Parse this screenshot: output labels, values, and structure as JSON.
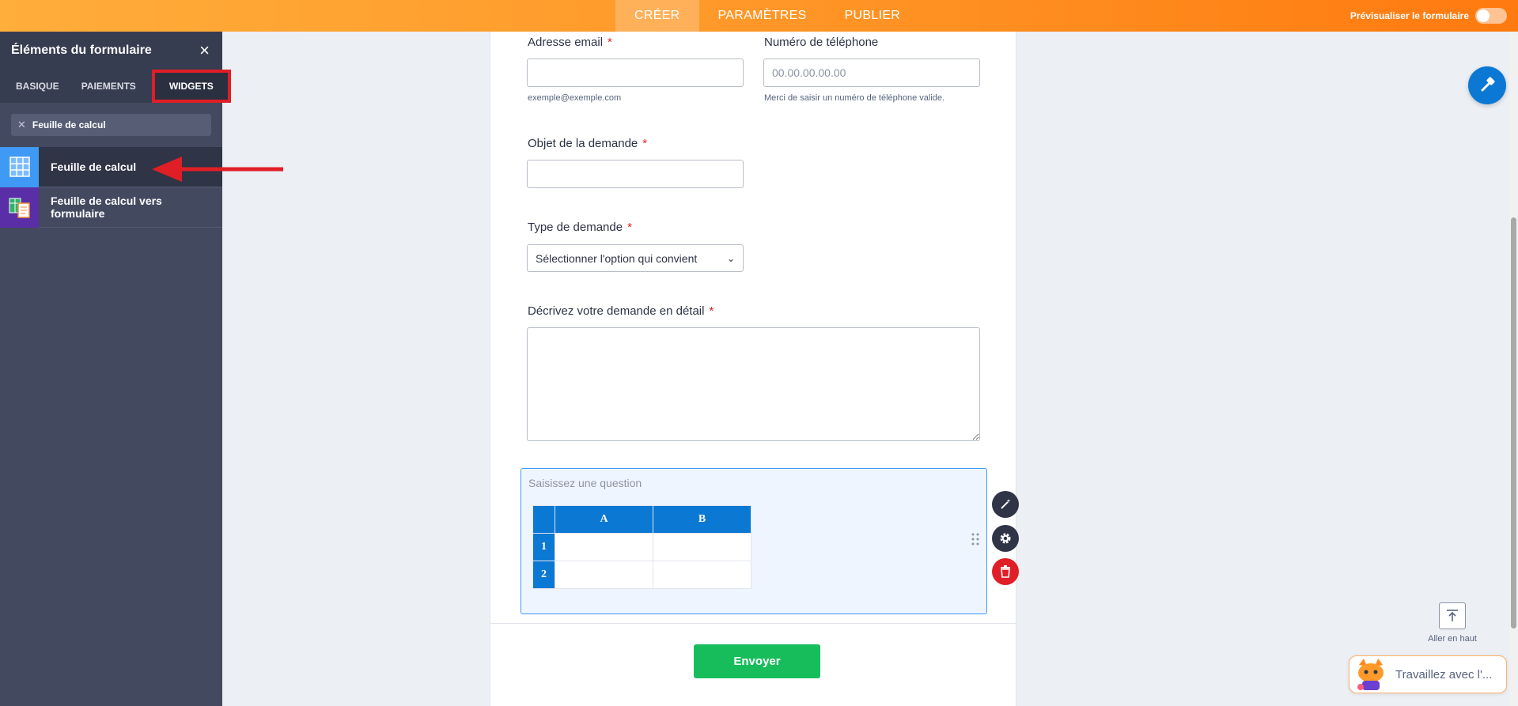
{
  "topbar": {
    "tabs": [
      {
        "label": "CRÉER"
      },
      {
        "label": "PARAMÈTRES"
      },
      {
        "label": "PUBLIER"
      }
    ],
    "preview_label": "Prévisualiser le formulaire"
  },
  "sidebar": {
    "title": "Éléments du formulaire",
    "tabs": [
      {
        "label": "BASIQUE"
      },
      {
        "label": "PAIEMENTS"
      },
      {
        "label": "WIDGETS"
      }
    ],
    "search_value": "Feuille de calcul",
    "items": [
      {
        "label": "Feuille de calcul"
      },
      {
        "label": "Feuille de calcul vers formulaire"
      }
    ]
  },
  "form": {
    "email": {
      "label": "Adresse email",
      "required": "*",
      "value": "",
      "hint": "exemple@exemple.com"
    },
    "phone": {
      "label": "Numéro de téléphone",
      "placeholder": "00.00.00.00.00",
      "hint": "Merci de saisir un numéro de téléphone valide."
    },
    "subject": {
      "label": "Objet de la demande",
      "required": "*"
    },
    "type": {
      "label": "Type de demande",
      "required": "*",
      "selected": "Sélectionner l'option qui convient"
    },
    "details": {
      "label": "Décrivez votre demande en détail",
      "required": "*"
    },
    "sheet": {
      "question_placeholder": "Saisissez une question",
      "columns": [
        "A",
        "B"
      ],
      "rows": [
        "1",
        "2"
      ]
    },
    "submit_label": "Envoyer"
  },
  "floating": {
    "to_top_label": "Aller en haut",
    "ai_label": "Travaillez avec l'..."
  },
  "colors": {
    "accent_orange": "#ff8a1f",
    "blue": "#0b78d4",
    "green": "#18bd5b",
    "red": "#e01e26"
  }
}
